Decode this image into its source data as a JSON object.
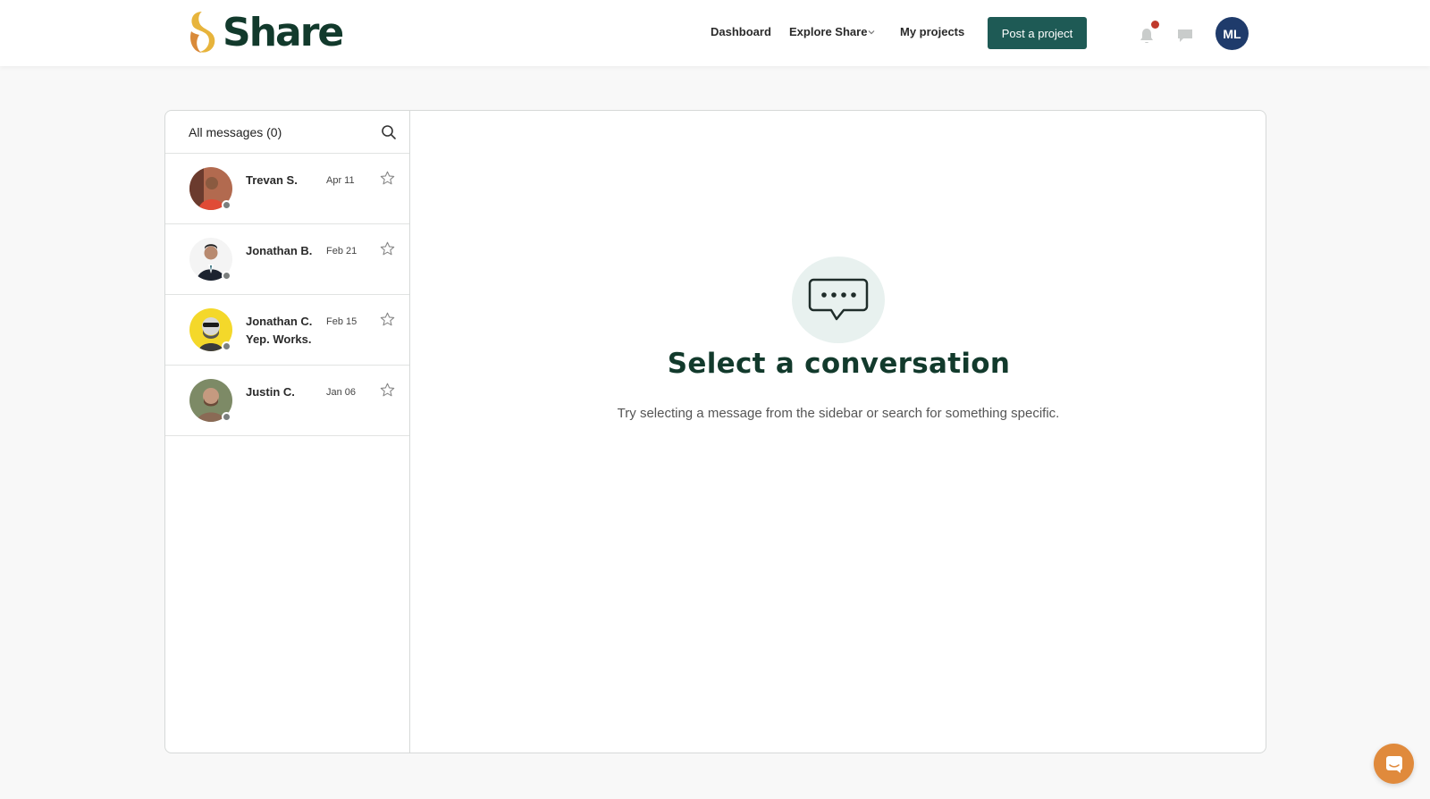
{
  "brand": {
    "name": "Share",
    "accent": "#1e5a55",
    "logo_colors": [
      "#e7b43c",
      "#d98a3a"
    ]
  },
  "nav": {
    "dashboard": "Dashboard",
    "explore": "Explore Share",
    "my_projects": "My projects",
    "post_project": "Post a project"
  },
  "user": {
    "initials": "ML"
  },
  "sidebar": {
    "title": "All messages (0)",
    "conversations": [
      {
        "name": "Trevan S.",
        "date": "Apr 11",
        "preview": "",
        "avatar_bg": "#a5533a",
        "avatar_fg": "#e04b36"
      },
      {
        "name": "Jonathan B.",
        "date": "Feb 21",
        "preview": "",
        "avatar_bg": "#f2f2f2",
        "avatar_fg": "#1c2330"
      },
      {
        "name": "Jonathan C.",
        "date": "Feb 15",
        "preview": "Yep. Works.",
        "avatar_bg": "#f4d82a",
        "avatar_fg": "#3b3b3b"
      },
      {
        "name": "Justin C.",
        "date": "Jan 06",
        "preview": "",
        "avatar_bg": "#7d8a66",
        "avatar_fg": "#8a6a55"
      }
    ]
  },
  "empty_state": {
    "title": "Select a conversation",
    "description": "Try selecting a message from the sidebar or search for something specific."
  }
}
